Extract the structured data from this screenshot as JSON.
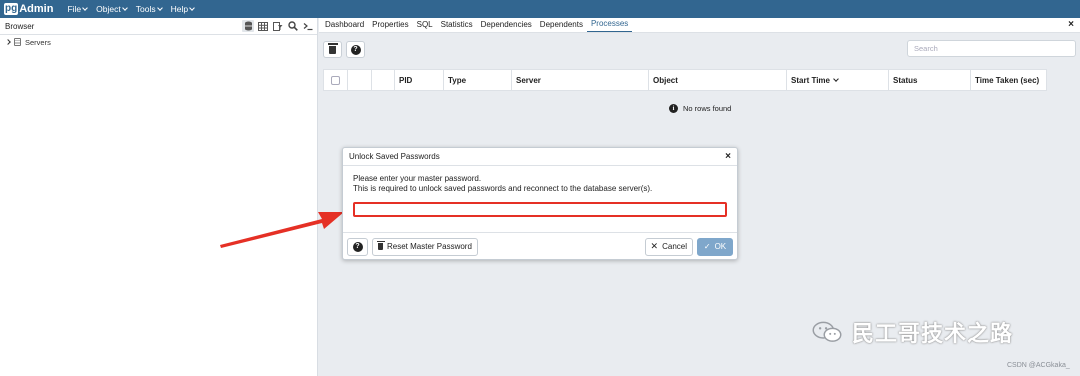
{
  "navbar": {
    "logo_pg": "pg",
    "logo_admin": "Admin",
    "menus": [
      "File",
      "Object",
      "Tools",
      "Help"
    ]
  },
  "browser": {
    "title": "Browser",
    "tree": [
      {
        "label": "Servers"
      }
    ]
  },
  "main": {
    "tabs": [
      "Dashboard",
      "Properties",
      "SQL",
      "Statistics",
      "Dependencies",
      "Dependents",
      "Processes"
    ],
    "active_tab": "Processes",
    "search_placeholder": "Search",
    "columns": [
      "PID",
      "Type",
      "Server",
      "Object",
      "Start Time",
      "Status",
      "Time Taken (sec)"
    ],
    "empty_message": "No rows found"
  },
  "dialog": {
    "title": "Unlock Saved Passwords",
    "line1": "Please enter your master password.",
    "line2": "This is required to unlock saved passwords and reconnect to the database server(s).",
    "password_value": "",
    "reset_label": "Reset Master Password",
    "cancel_label": "Cancel",
    "ok_label": "OK"
  },
  "watermark": {
    "text": "民工哥技术之路",
    "credit": "CSDN @ACGkaka_"
  },
  "colors": {
    "navbar": "#326690",
    "annotation_red": "#e53025",
    "ok_button": "#7fa7cb"
  }
}
